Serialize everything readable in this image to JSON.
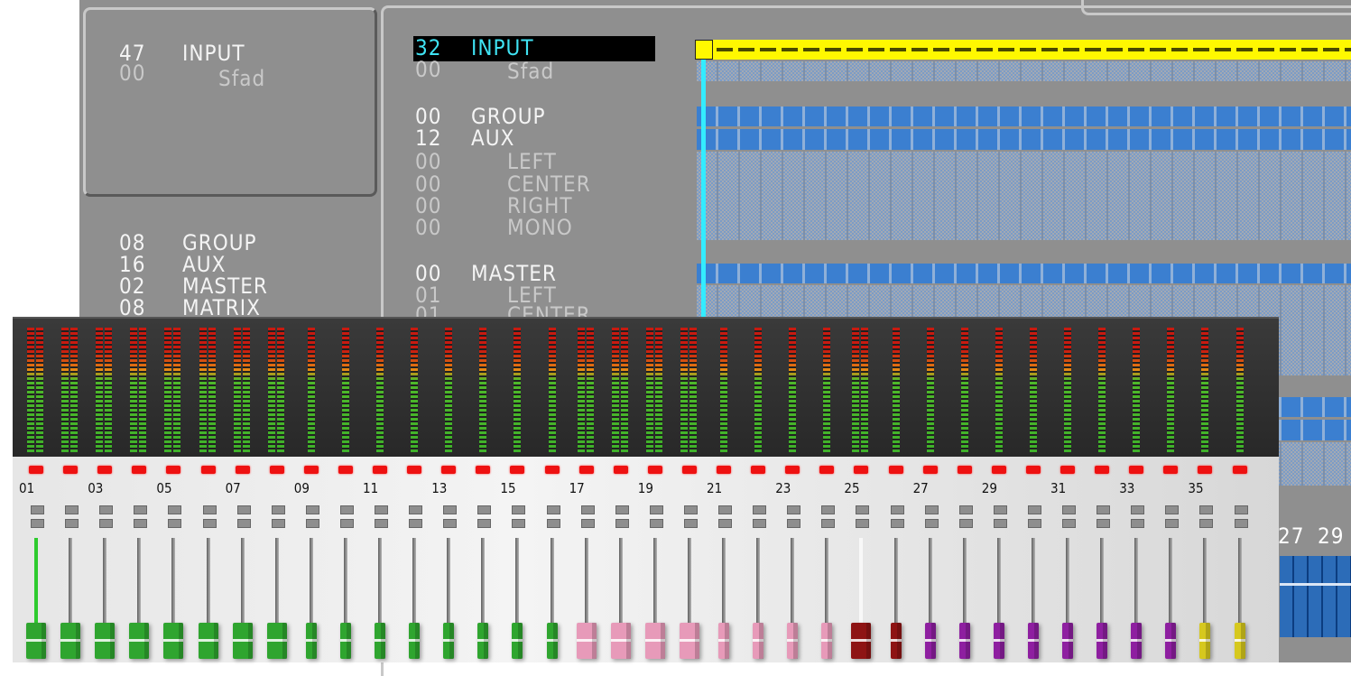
{
  "left_summary": {
    "rows": [
      {
        "num": "47",
        "label": "INPUT"
      },
      {
        "num": "00",
        "label": "Sfad"
      },
      {
        "num": "08",
        "label": "GROUP"
      },
      {
        "num": "16",
        "label": "AUX"
      },
      {
        "num": "02",
        "label": "MASTER"
      },
      {
        "num": "08",
        "label": "MATRIX"
      }
    ]
  },
  "routing_list": {
    "rows": [
      {
        "num": "32",
        "label": "INPUT",
        "selected": true
      },
      {
        "num": "00",
        "label": "Sfad"
      },
      {
        "num": "00",
        "label": "GROUP"
      },
      {
        "num": "12",
        "label": "AUX"
      },
      {
        "num": "00",
        "label": "LEFT"
      },
      {
        "num": "00",
        "label": "CENTER"
      },
      {
        "num": "00",
        "label": "RIGHT"
      },
      {
        "num": "00",
        "label": "MONO"
      },
      {
        "num": "00",
        "label": "MASTER"
      },
      {
        "num": "01",
        "label": "LEFT"
      },
      {
        "num": "01",
        "label": "CENTER"
      }
    ]
  },
  "grid_right_labels": [
    "27",
    "29"
  ],
  "mixer": {
    "channel_labels": [
      "01",
      "03",
      "05",
      "07",
      "09",
      "11",
      "13",
      "15",
      "17",
      "19",
      "21",
      "23",
      "25",
      "27",
      "29",
      "31",
      "33",
      "35"
    ],
    "fader_colors": {
      "green": "#2fa52f",
      "pink": "#e79ab9",
      "darkred": "#8e1414",
      "purple": "#8e1fa0",
      "yellow": "#d6c81e"
    },
    "strips": [
      {
        "color": "green",
        "wide": true,
        "dual_meter": true,
        "track": "hot"
      },
      {
        "color": "green",
        "wide": true,
        "dual_meter": true
      },
      {
        "color": "green",
        "wide": true,
        "dual_meter": true
      },
      {
        "color": "green",
        "wide": true,
        "dual_meter": true
      },
      {
        "color": "green",
        "wide": true,
        "dual_meter": true
      },
      {
        "color": "green",
        "wide": true,
        "dual_meter": true
      },
      {
        "color": "green",
        "wide": true,
        "dual_meter": true
      },
      {
        "color": "green",
        "wide": true,
        "dual_meter": true
      },
      {
        "color": "green"
      },
      {
        "color": "green"
      },
      {
        "color": "green"
      },
      {
        "color": "green"
      },
      {
        "color": "green"
      },
      {
        "color": "green"
      },
      {
        "color": "green"
      },
      {
        "color": "green"
      },
      {
        "color": "pink",
        "wide": true,
        "dual_meter": true
      },
      {
        "color": "pink",
        "wide": true,
        "dual_meter": true
      },
      {
        "color": "pink",
        "wide": true,
        "dual_meter": true
      },
      {
        "color": "pink",
        "wide": true,
        "dual_meter": true
      },
      {
        "color": "pink"
      },
      {
        "color": "pink"
      },
      {
        "color": "pink"
      },
      {
        "color": "pink"
      },
      {
        "color": "darkred",
        "wide": true,
        "dual_meter": true,
        "track": "white"
      },
      {
        "color": "darkred"
      },
      {
        "color": "purple"
      },
      {
        "color": "purple"
      },
      {
        "color": "purple"
      },
      {
        "color": "purple"
      },
      {
        "color": "purple"
      },
      {
        "color": "purple"
      },
      {
        "color": "purple"
      },
      {
        "color": "purple"
      },
      {
        "color": "yellow"
      },
      {
        "color": "yellow"
      }
    ]
  },
  "colors": {
    "selection_text": "#3fe2f2",
    "grid_header": "#fff800",
    "grid_cursor": "#33ecff",
    "grid_cell": "#3b7fd0"
  }
}
